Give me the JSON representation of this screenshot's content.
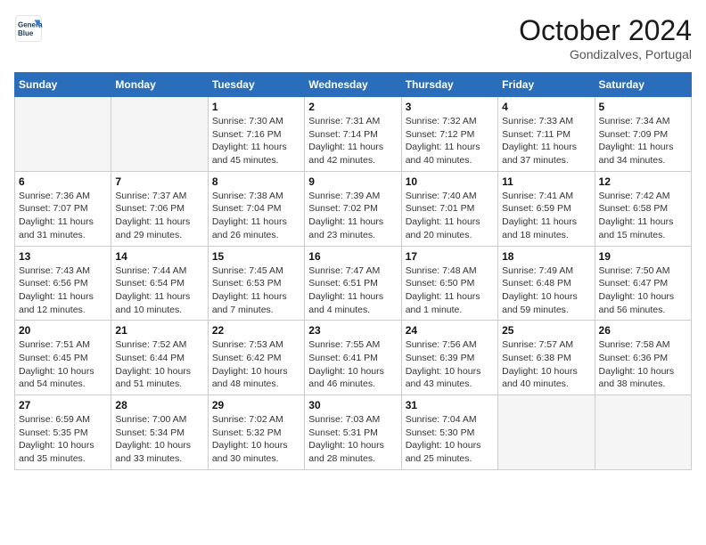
{
  "header": {
    "logo_line1": "General",
    "logo_line2": "Blue",
    "month": "October 2024",
    "location": "Gondizalves, Portugal"
  },
  "days_of_week": [
    "Sunday",
    "Monday",
    "Tuesday",
    "Wednesday",
    "Thursday",
    "Friday",
    "Saturday"
  ],
  "weeks": [
    [
      {
        "day": "",
        "info": ""
      },
      {
        "day": "",
        "info": ""
      },
      {
        "day": "1",
        "info": "Sunrise: 7:30 AM\nSunset: 7:16 PM\nDaylight: 11 hours and 45 minutes."
      },
      {
        "day": "2",
        "info": "Sunrise: 7:31 AM\nSunset: 7:14 PM\nDaylight: 11 hours and 42 minutes."
      },
      {
        "day": "3",
        "info": "Sunrise: 7:32 AM\nSunset: 7:12 PM\nDaylight: 11 hours and 40 minutes."
      },
      {
        "day": "4",
        "info": "Sunrise: 7:33 AM\nSunset: 7:11 PM\nDaylight: 11 hours and 37 minutes."
      },
      {
        "day": "5",
        "info": "Sunrise: 7:34 AM\nSunset: 7:09 PM\nDaylight: 11 hours and 34 minutes."
      }
    ],
    [
      {
        "day": "6",
        "info": "Sunrise: 7:36 AM\nSunset: 7:07 PM\nDaylight: 11 hours and 31 minutes."
      },
      {
        "day": "7",
        "info": "Sunrise: 7:37 AM\nSunset: 7:06 PM\nDaylight: 11 hours and 29 minutes."
      },
      {
        "day": "8",
        "info": "Sunrise: 7:38 AM\nSunset: 7:04 PM\nDaylight: 11 hours and 26 minutes."
      },
      {
        "day": "9",
        "info": "Sunrise: 7:39 AM\nSunset: 7:02 PM\nDaylight: 11 hours and 23 minutes."
      },
      {
        "day": "10",
        "info": "Sunrise: 7:40 AM\nSunset: 7:01 PM\nDaylight: 11 hours and 20 minutes."
      },
      {
        "day": "11",
        "info": "Sunrise: 7:41 AM\nSunset: 6:59 PM\nDaylight: 11 hours and 18 minutes."
      },
      {
        "day": "12",
        "info": "Sunrise: 7:42 AM\nSunset: 6:58 PM\nDaylight: 11 hours and 15 minutes."
      }
    ],
    [
      {
        "day": "13",
        "info": "Sunrise: 7:43 AM\nSunset: 6:56 PM\nDaylight: 11 hours and 12 minutes."
      },
      {
        "day": "14",
        "info": "Sunrise: 7:44 AM\nSunset: 6:54 PM\nDaylight: 11 hours and 10 minutes."
      },
      {
        "day": "15",
        "info": "Sunrise: 7:45 AM\nSunset: 6:53 PM\nDaylight: 11 hours and 7 minutes."
      },
      {
        "day": "16",
        "info": "Sunrise: 7:47 AM\nSunset: 6:51 PM\nDaylight: 11 hours and 4 minutes."
      },
      {
        "day": "17",
        "info": "Sunrise: 7:48 AM\nSunset: 6:50 PM\nDaylight: 11 hours and 1 minute."
      },
      {
        "day": "18",
        "info": "Sunrise: 7:49 AM\nSunset: 6:48 PM\nDaylight: 10 hours and 59 minutes."
      },
      {
        "day": "19",
        "info": "Sunrise: 7:50 AM\nSunset: 6:47 PM\nDaylight: 10 hours and 56 minutes."
      }
    ],
    [
      {
        "day": "20",
        "info": "Sunrise: 7:51 AM\nSunset: 6:45 PM\nDaylight: 10 hours and 54 minutes."
      },
      {
        "day": "21",
        "info": "Sunrise: 7:52 AM\nSunset: 6:44 PM\nDaylight: 10 hours and 51 minutes."
      },
      {
        "day": "22",
        "info": "Sunrise: 7:53 AM\nSunset: 6:42 PM\nDaylight: 10 hours and 48 minutes."
      },
      {
        "day": "23",
        "info": "Sunrise: 7:55 AM\nSunset: 6:41 PM\nDaylight: 10 hours and 46 minutes."
      },
      {
        "day": "24",
        "info": "Sunrise: 7:56 AM\nSunset: 6:39 PM\nDaylight: 10 hours and 43 minutes."
      },
      {
        "day": "25",
        "info": "Sunrise: 7:57 AM\nSunset: 6:38 PM\nDaylight: 10 hours and 40 minutes."
      },
      {
        "day": "26",
        "info": "Sunrise: 7:58 AM\nSunset: 6:36 PM\nDaylight: 10 hours and 38 minutes."
      }
    ],
    [
      {
        "day": "27",
        "info": "Sunrise: 6:59 AM\nSunset: 5:35 PM\nDaylight: 10 hours and 35 minutes."
      },
      {
        "day": "28",
        "info": "Sunrise: 7:00 AM\nSunset: 5:34 PM\nDaylight: 10 hours and 33 minutes."
      },
      {
        "day": "29",
        "info": "Sunrise: 7:02 AM\nSunset: 5:32 PM\nDaylight: 10 hours and 30 minutes."
      },
      {
        "day": "30",
        "info": "Sunrise: 7:03 AM\nSunset: 5:31 PM\nDaylight: 10 hours and 28 minutes."
      },
      {
        "day": "31",
        "info": "Sunrise: 7:04 AM\nSunset: 5:30 PM\nDaylight: 10 hours and 25 minutes."
      },
      {
        "day": "",
        "info": ""
      },
      {
        "day": "",
        "info": ""
      }
    ]
  ]
}
